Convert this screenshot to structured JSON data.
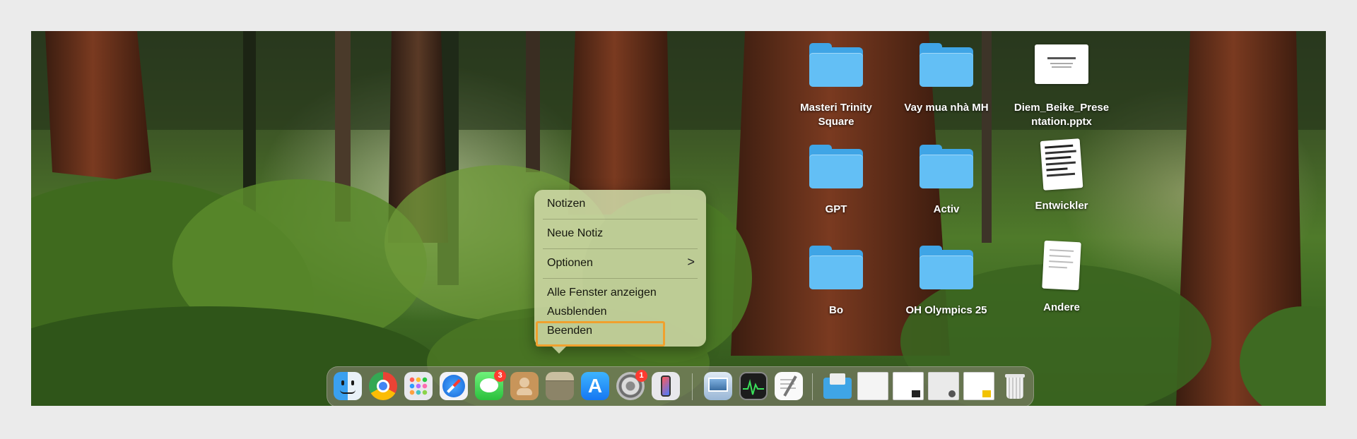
{
  "desktop_icons": [
    {
      "label": "Masteri Trinity\nSquare",
      "type": "folder"
    },
    {
      "label": "Vay mua nhà MH",
      "type": "folder"
    },
    {
      "label": "Diem_Beike_Prese\nntation.pptx",
      "type": "document"
    },
    {
      "label": "GPT",
      "type": "folder"
    },
    {
      "label": "Activ",
      "type": "folder"
    },
    {
      "label": "Entwickler",
      "type": "stack"
    },
    {
      "label": "Bo",
      "type": "folder"
    },
    {
      "label": "OH Olympics 25",
      "type": "folder"
    },
    {
      "label": "Andere",
      "type": "stack"
    }
  ],
  "context_menu": {
    "items": {
      "notizen": "Notizen",
      "neue_notiz": "Neue Notiz",
      "optionen": "Optionen",
      "alle_fenster": "Alle Fenster anzeigen",
      "ausblenden": "Ausblenden",
      "beenden": "Beenden"
    },
    "chevron": ">",
    "highlight_color": "#f0a12e"
  },
  "dock": {
    "messages_badge": "3",
    "settings_badge": "1",
    "apps": [
      "finder-icon",
      "chrome-icon",
      "launchpad-icon",
      "safari-icon",
      "messages-icon",
      "contacts-icon",
      "notes-icon",
      "app-store-icon",
      "system-settings-icon",
      "iphone-mirroring-icon",
      "preview-icon",
      "activity-monitor-icon",
      "textedit-icon",
      "downloads-folder-icon",
      "recent-document-icon",
      "trash-icon"
    ]
  },
  "colors": {
    "folder": "#3fa5e6",
    "badge": "#ff3b30"
  }
}
